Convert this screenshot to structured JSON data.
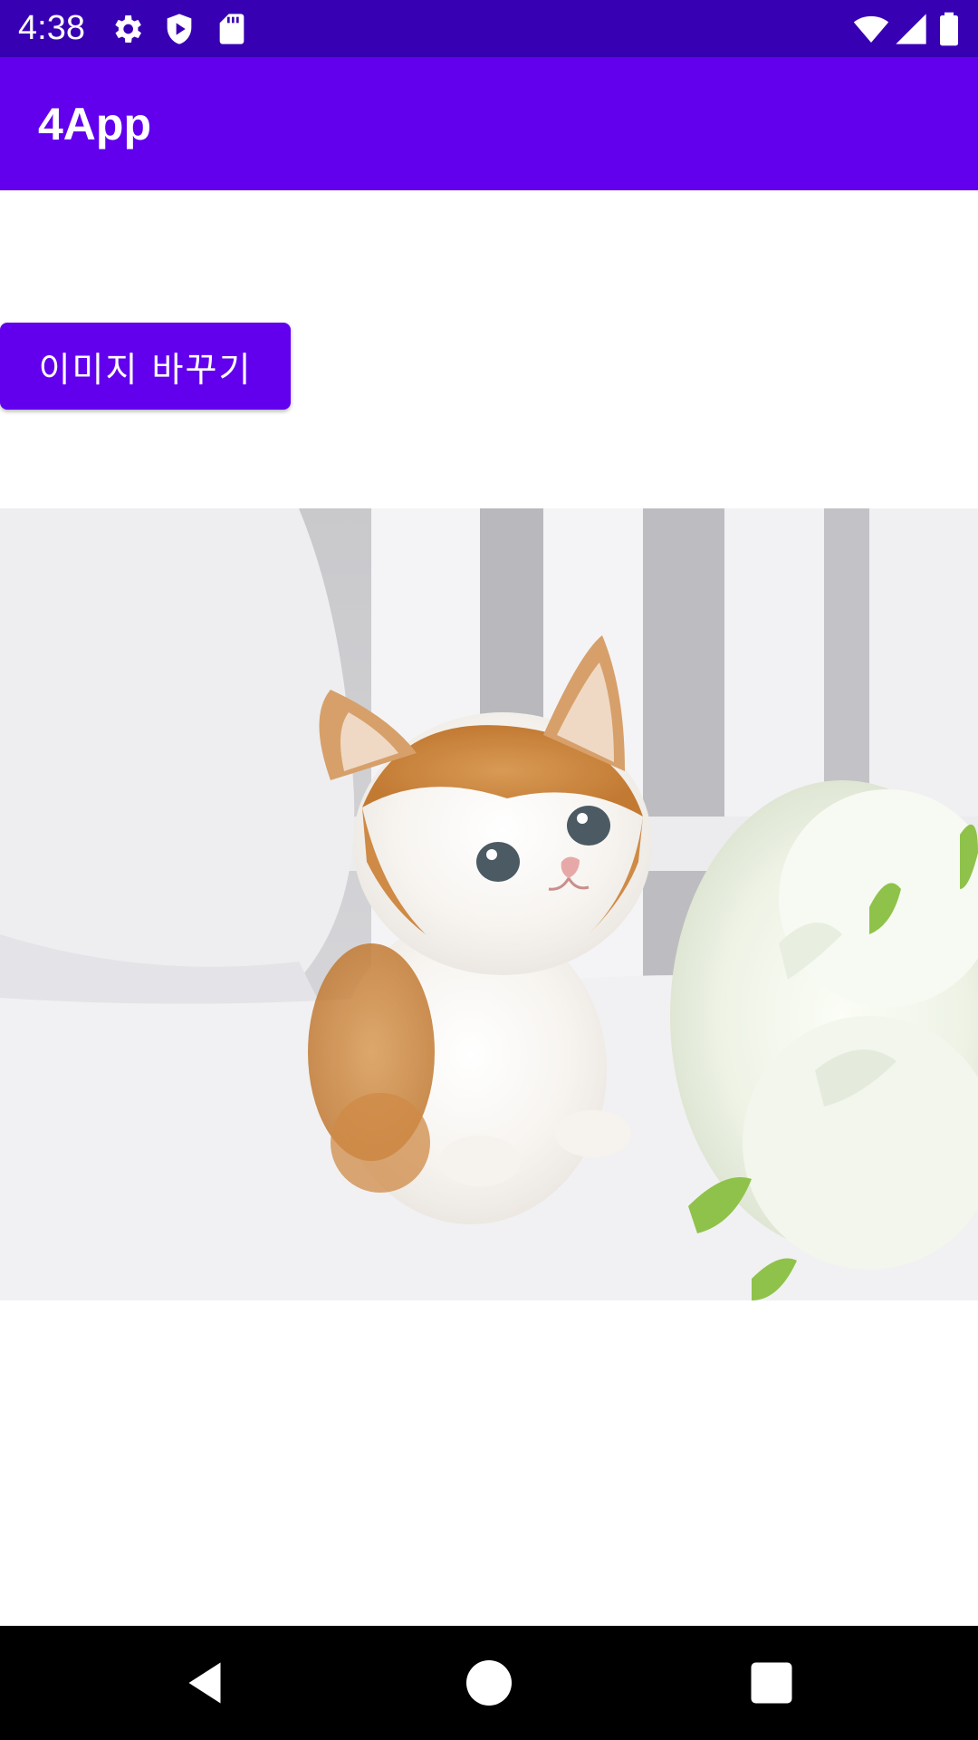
{
  "status_bar": {
    "time": "4:38",
    "icons_left": [
      "settings-gear-icon",
      "play-protect-shield-icon",
      "sd-card-icon"
    ],
    "icons_right": [
      "wifi-icon",
      "cell-signal-icon",
      "battery-icon"
    ]
  },
  "app_bar": {
    "title": "4App",
    "color": "#6200ee"
  },
  "main": {
    "change_image_button_label": "이미지 바꾸기",
    "image": {
      "subject": "kitten-photo"
    }
  },
  "nav_bar": {
    "buttons": [
      "back-icon",
      "home-icon",
      "recents-icon"
    ]
  },
  "colors": {
    "status_bar": "#3700b3",
    "primary": "#6200ee",
    "nav_bar": "#000000"
  }
}
